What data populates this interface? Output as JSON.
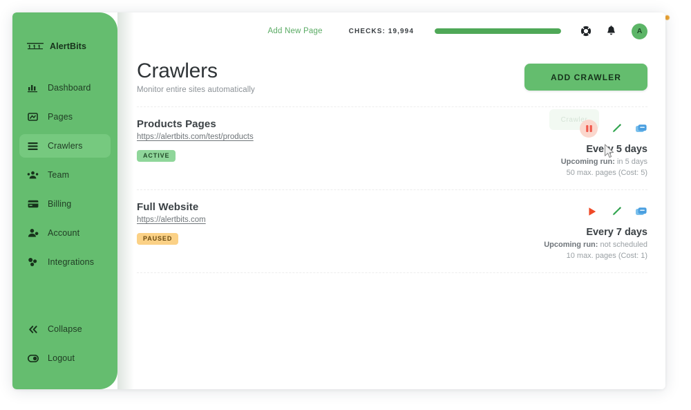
{
  "brand": {
    "name": "AlertBits",
    "icon": "alertbits-logo-icon"
  },
  "sidebar": {
    "items": [
      {
        "label": "Dashboard",
        "icon": "chart-bar-icon",
        "active": false
      },
      {
        "label": "Pages",
        "icon": "pages-icon",
        "active": false
      },
      {
        "label": "Crawlers",
        "icon": "crawlers-list-icon",
        "active": true
      },
      {
        "label": "Team",
        "icon": "team-users-icon",
        "active": false
      },
      {
        "label": "Billing",
        "icon": "credit-card-icon",
        "active": false
      },
      {
        "label": "Account",
        "icon": "user-account-icon",
        "active": false
      },
      {
        "label": "Integrations",
        "icon": "integrations-nodes-icon",
        "active": false
      }
    ],
    "bottom_items": [
      {
        "label": "Collapse",
        "icon": "chevrons-left-icon"
      },
      {
        "label": "Logout",
        "icon": "logout-toggle-icon"
      }
    ],
    "bg_color": "#65bd6f",
    "active_color": "#76c97f"
  },
  "topbar": {
    "add_new_page": "Add New Page",
    "checks_label": "CHECKS: 19,994",
    "progress_percent": 100,
    "help_icon": "lifebuoy-icon",
    "bell_icon": "bell-notification-icon",
    "avatar_initial": "A"
  },
  "header": {
    "title": "Crawlers",
    "subtitle": "Monitor entire sites automatically",
    "add_button": "ADD CRAWLER"
  },
  "ghost_toast": {
    "text": "Crawler"
  },
  "crawlers": [
    {
      "title": "Products Pages",
      "url": "https://alertbits.com/test/products",
      "status": "ACTIVE",
      "status_type": "active",
      "frequency": "Every 5 days",
      "upcoming_label": "Upcoming run:",
      "upcoming_value": "in 5 days",
      "limits": "50 max. pages (Cost: 5)",
      "actions": [
        {
          "icon": "pause-button-icon",
          "color": "#f05a4e"
        },
        {
          "icon": "edit-pencil-icon",
          "color": "#35a853"
        },
        {
          "icon": "duplicate-icon",
          "color": "#4a9fe0"
        }
      ]
    },
    {
      "title": "Full Website",
      "url": "https://alertbits.com",
      "status": "PAUSED",
      "status_type": "paused",
      "frequency": "Every 7 days",
      "upcoming_label": "Upcoming run:",
      "upcoming_value": "not scheduled",
      "limits": "10 max. pages (Cost: 1)",
      "actions": [
        {
          "icon": "play-button-icon",
          "color": "#ef4a28"
        },
        {
          "icon": "edit-pencil-icon",
          "color": "#35a853"
        },
        {
          "icon": "duplicate-icon",
          "color": "#4a9fe0"
        }
      ]
    }
  ],
  "colors": {
    "brand_green": "#65bd6f",
    "progress_green": "#4fa857",
    "badge_active": "#8fd69a",
    "badge_paused": "#fbd186",
    "accent_dot": "#e8920c"
  }
}
